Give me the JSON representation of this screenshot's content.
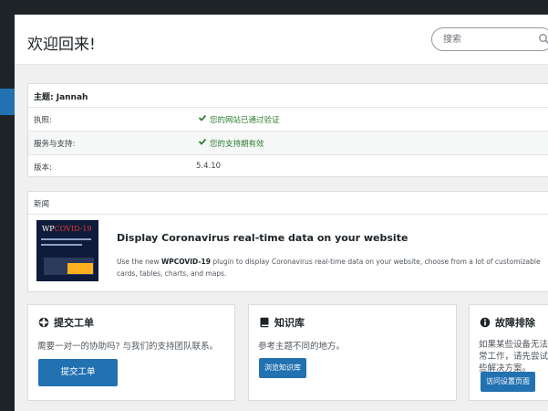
{
  "header": {
    "title": "欢迎回来!",
    "search_placeholder": "搜索"
  },
  "theme": {
    "title": "主题: Jannah",
    "rows": [
      {
        "label": "执照:",
        "value": "您的网站已通过验证",
        "status": "ok"
      },
      {
        "label": "服务与支持:",
        "value": "您的支持期有效",
        "status": "ok"
      },
      {
        "label": "版本:",
        "value": "5.4.10",
        "status": "plain"
      }
    ]
  },
  "news": {
    "heading": "新闻",
    "thumb_brand_a": "WP",
    "thumb_brand_b": "COVID-19",
    "title": "Display Coronavirus real-time data on your website",
    "desc_prefix": "Use the new ",
    "desc_plugin": "WPCOVID-19",
    "desc_suffix": " plugin to display Coronavirus real-time data on your website, choose from a lot of customizable cards, tables, charts, and maps."
  },
  "boxes": [
    {
      "title": "提交工单",
      "icon": "life-ring-icon",
      "desc": "需要一对一的协助吗? 与我们的支持团队联系。",
      "button": "提交工单"
    },
    {
      "title": "知识库",
      "icon": "book-icon",
      "desc": "参考主题不同的地方。",
      "button": "浏览知识库"
    },
    {
      "title": "故障排除",
      "icon": "info-icon",
      "desc": "如果某些设备无法正常工作，请先尝试这些解决方案。",
      "button": "访问设置页面"
    }
  ],
  "colors": {
    "admin_bar": "#1d2327",
    "accent": "#2271b1",
    "success": "#2d7d32"
  }
}
